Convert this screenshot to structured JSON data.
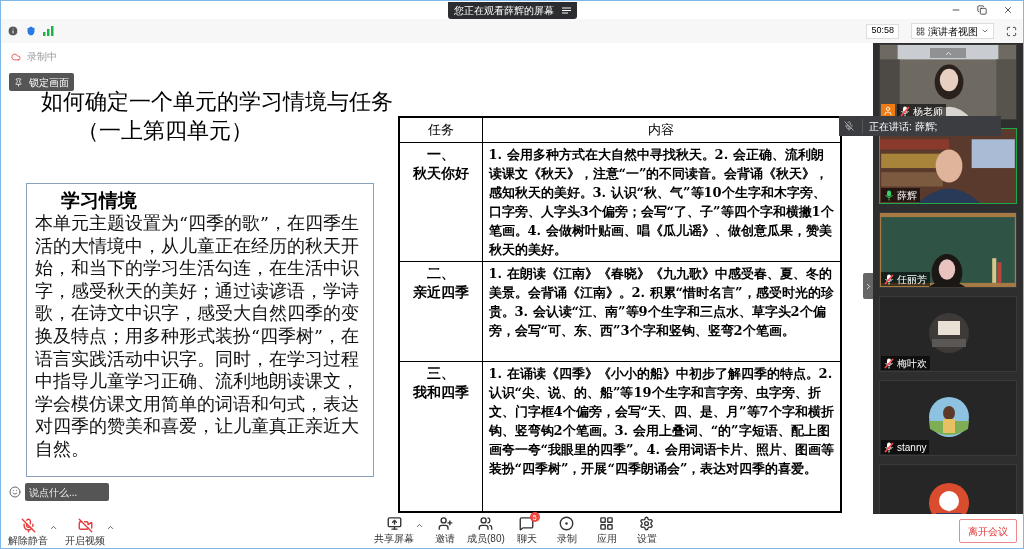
{
  "share_banner": {
    "text": "您正在观看薛辉的屏幕"
  },
  "top_bar": {
    "timer": "50:58",
    "view_button": "演讲者视图"
  },
  "recording_status": "录制中",
  "lock_button": "锁定画面",
  "slide": {
    "title_lines": [
      "如何确定一个单元的学习情境与任务",
      "（一上第四单元）"
    ],
    "context_box": {
      "heading": "学习情境",
      "body": "本单元主题设置为“四季的歌”，在四季生活的大情境中，从儿童正在经历的秋天开始，和当下的学习生活勾连，在生活中识字，感受秋天的美好；通过读谚语，学诗歌，在诗文中识字，感受大自然四季的变换及特点；用多种形式装扮“四季树”，在语言实践活动中识字。同时，在学习过程中指导儿童学习正确、流利地朗读课文，学会模仿课文用简单的词语和句式，表达对四季的赞美和喜爱，让儿童真正亲近大自然。"
    },
    "table": {
      "columns": [
        "任务",
        "内容"
      ],
      "rows": [
        {
          "task_lines": [
            "一、",
            "秋天你好"
          ],
          "content": "1. 会用多种方式在大自然中寻找秋天。2. 会正确、流利朗读课文《秋天》，注意“一”的不同读音。会背诵《秋天》，感知秋天的美好。3. 认识“秋、气”等10个生字和木字旁、口字旁、人字头3个偏旁；会写“了、子”等四个字和横撇1个笔画。4. 会做树叶贴画、唱《瓜儿谣》、做创意瓜果，赞美秋天的美好。"
        },
        {
          "task_lines": [
            "二、",
            "亲近四季"
          ],
          "content": "1. 在朗读《江南》《春晓》《九九歌》中感受春、夏、冬的美景。会背诵《江南》。2. 积累“惜时名言”，感受时光的珍贵。3. 会认读“江、南”等9个生字和三点水、草字头2个偏旁，会写“可、东、西”3个字和竖钩、竖弯2个笔画。"
        },
        {
          "task_lines": [
            "三、",
            "我和四季"
          ],
          "content": "1. 在诵读《四季》《小小的船》中初步了解四季的特点。2. 认识“尖、说、的、船”等19个生字和言字旁、虫字旁、折文、门字框4个偏旁，会写“天、四、是、月”等7个字和横折钩、竖弯钩2个笔画。3. 会用上叠词、“的”字短语、配上图画夸一夸“我眼里的四季”。4. 会用词语卡片、照片、图画等装扮“四季树”，开展“四季朗诵会”，表达对四季的喜爱。"
        }
      ]
    }
  },
  "chat_input": {
    "placeholder": "说点什么..."
  },
  "speaking_banner": {
    "text": "正在讲话: 薛辉;"
  },
  "participants": [
    {
      "kind": "video",
      "name": "杨老师",
      "muted": true,
      "speaking": false,
      "host": true
    },
    {
      "kind": "video",
      "name": "薛辉",
      "muted": false,
      "speaking": true,
      "host": false
    },
    {
      "kind": "video",
      "name": "任丽芳",
      "muted": true,
      "speaking": false,
      "host": false
    },
    {
      "kind": "avatar",
      "name": "梅叶欢",
      "muted": true,
      "speaking": false,
      "host": false
    },
    {
      "kind": "avatar",
      "name": "stanny",
      "muted": true,
      "speaking": false,
      "host": false
    },
    {
      "kind": "avatar",
      "speaking": false
    }
  ],
  "toolbar": {
    "left": [
      {
        "kind": "mic",
        "label": "解除静音",
        "caret": true
      },
      {
        "kind": "video",
        "label": "开启视频",
        "caret": true
      }
    ],
    "center": [
      {
        "kind": "share",
        "label": "共享屏幕",
        "caret": true
      },
      {
        "kind": "invite",
        "label": "邀请",
        "caret": false
      },
      {
        "kind": "members",
        "label": "成员(80)",
        "caret": false
      },
      {
        "kind": "chat",
        "label": "聊天",
        "caret": false,
        "badge": "5"
      },
      {
        "kind": "record",
        "label": "录制",
        "caret": false
      },
      {
        "kind": "apps",
        "label": "应用",
        "caret": false
      },
      {
        "kind": "settings",
        "label": "设置",
        "caret": false
      }
    ],
    "leave_button": "离开会议"
  }
}
